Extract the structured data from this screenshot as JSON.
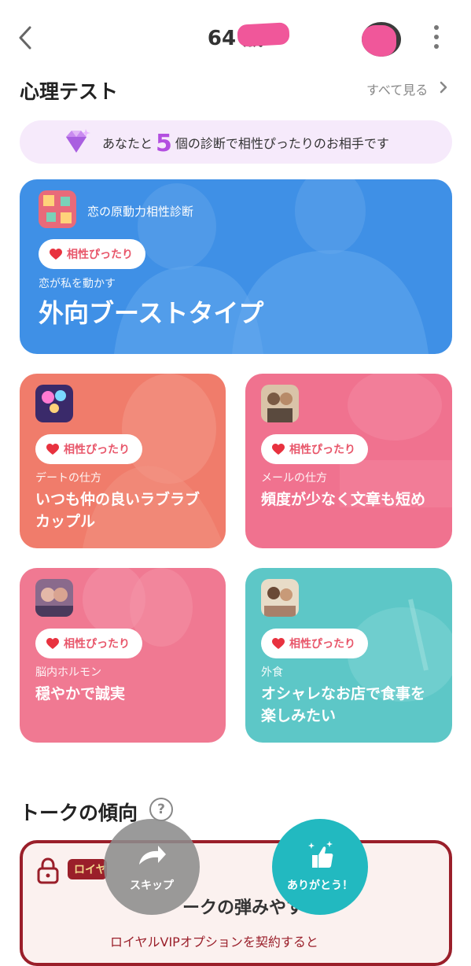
{
  "header": {
    "title": "64 歳"
  },
  "psych": {
    "title": "心理テスト",
    "see_all": "すべて見る",
    "banner_prefix": "あなたと",
    "banner_count": "5",
    "banner_suffix": "個の診断で相性ぴったりのお相手です"
  },
  "cards": [
    {
      "test": "恋の原動力相性診断",
      "badge": "相性ぴったり",
      "category": "恋が私を動かす",
      "result": "外向ブーストタイプ"
    },
    {
      "badge": "相性ぴったり",
      "category": "デートの仕方",
      "result": "いつも仲の良いラブラブカップル"
    },
    {
      "badge": "相性ぴったり",
      "category": "メールの仕方",
      "result": "頻度が少なく文章も短め"
    },
    {
      "badge": "相性ぴったり",
      "category": "脳内ホルモン",
      "result": "穏やかで誠実"
    },
    {
      "badge": "相性ぴったり",
      "category": "外食",
      "result": "オシャレなお店で食事を楽しみたい"
    }
  ],
  "talk": {
    "title": "トークの傾向",
    "help": "?",
    "vip_badge": "ロイヤ",
    "locked_title": "ークの弾みやす",
    "locked_note": "ロイヤルVIPオプションを契約すると"
  },
  "actions": {
    "skip": "スキップ",
    "thanks": "ありがとう！"
  },
  "colors": {
    "accent_purple": "#b34fe0",
    "blue_card": "#3f90e6",
    "coral_card": "#f07c6b",
    "pink_card": "#f0728f",
    "teal_card": "#5dc7c7",
    "vip_red": "#9a1f2a",
    "thanks_button": "#22b9c0"
  }
}
